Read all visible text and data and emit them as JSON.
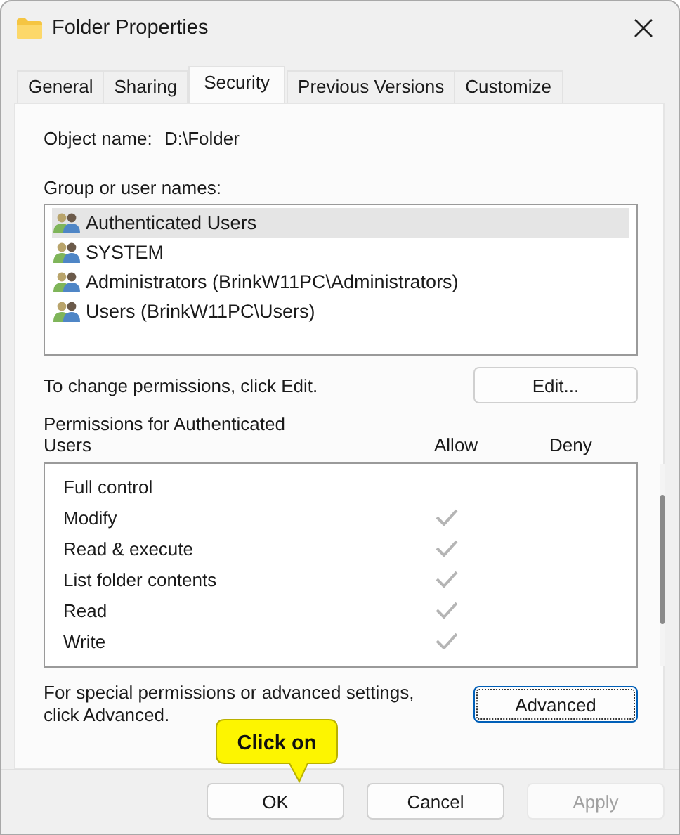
{
  "window": {
    "title": "Folder Properties"
  },
  "tabs": [
    {
      "label": "General",
      "selected": false
    },
    {
      "label": "Sharing",
      "selected": false
    },
    {
      "label": "Security",
      "selected": true
    },
    {
      "label": "Previous Versions",
      "selected": false
    },
    {
      "label": "Customize",
      "selected": false
    }
  ],
  "object_name": {
    "label": "Object name:",
    "value": "D:\\Folder"
  },
  "groups": {
    "label": "Group or user names:",
    "items": [
      {
        "name": "Authenticated Users",
        "selected": true
      },
      {
        "name": "SYSTEM",
        "selected": false
      },
      {
        "name": "Administrators (BrinkW11PC\\Administrators)",
        "selected": false
      },
      {
        "name": "Users (BrinkW11PC\\Users)",
        "selected": false
      }
    ]
  },
  "edit_hint": "To change permissions, click Edit.",
  "edit_button": "Edit...",
  "permissions": {
    "label": "Permissions for Authenticated Users",
    "allow_heading": "Allow",
    "deny_heading": "Deny",
    "rows": [
      {
        "name": "Full control",
        "allow": false,
        "deny": false
      },
      {
        "name": "Modify",
        "allow": true,
        "deny": false
      },
      {
        "name": "Read & execute",
        "allow": true,
        "deny": false
      },
      {
        "name": "List folder contents",
        "allow": true,
        "deny": false
      },
      {
        "name": "Read",
        "allow": true,
        "deny": false
      },
      {
        "name": "Write",
        "allow": true,
        "deny": false
      }
    ]
  },
  "advanced_hint": "For special permissions or advanced settings, click Advanced.",
  "advanced_button": "Advanced",
  "callout": {
    "text": "Click on"
  },
  "buttons": [
    {
      "label": "OK",
      "disabled": false
    },
    {
      "label": "Cancel",
      "disabled": false
    },
    {
      "label": "Apply",
      "disabled": true
    }
  ]
}
